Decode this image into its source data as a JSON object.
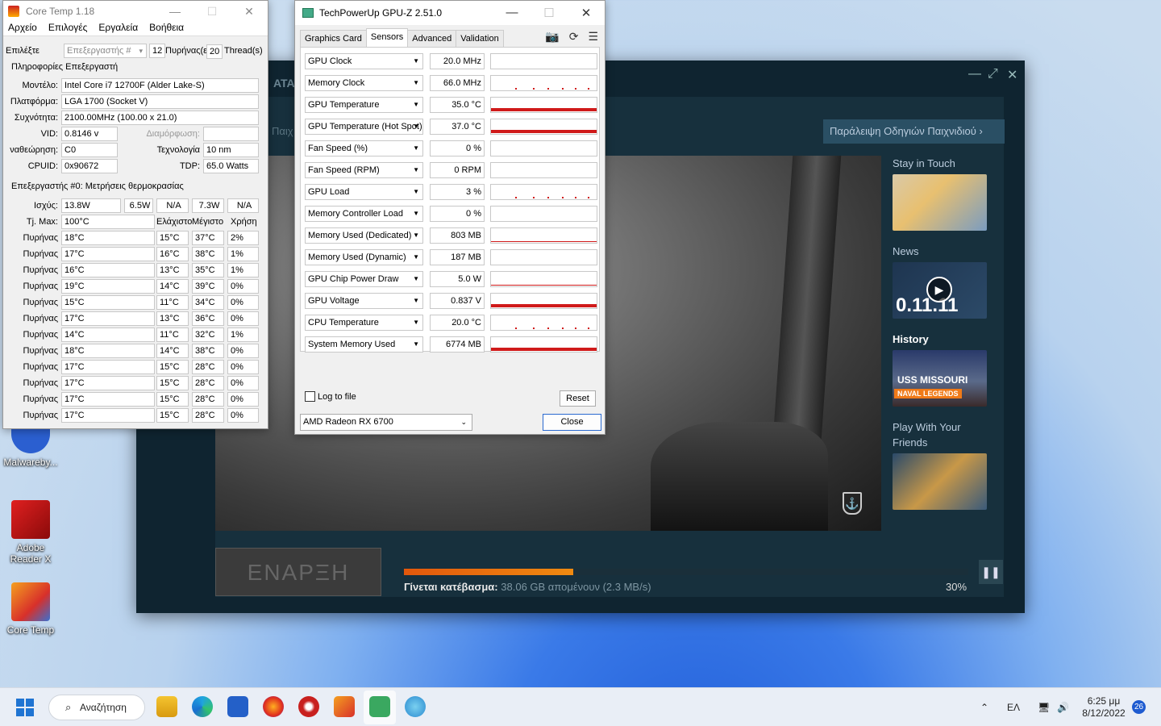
{
  "desktop": {
    "icons": [
      {
        "label": "Malwareby..."
      },
      {
        "label": "Adobe Reader X"
      },
      {
        "label": "Core Temp"
      }
    ]
  },
  "launcher": {
    "skip_button": "Παράλειψη Οδηγιών Παιχνιδιού",
    "sidebar": [
      {
        "title": "Stay in Touch"
      },
      {
        "title": "News",
        "badge": "0.11.11"
      },
      {
        "title": "History",
        "badge": "USS MISSOURI",
        "sub": "NAVAL LEGENDS"
      },
      {
        "title": "Play With Your Friends"
      }
    ],
    "start_button": "ΕΝΑΡΞΗ",
    "download": {
      "label": "Γίνεται κατέβασμα:",
      "remaining": "38.06 GB απομένουν",
      "speed": "(2.3 MB/s)",
      "percent_text": "30%",
      "progress": 0.3
    },
    "partial_text_1": "ΑΤΑΙ",
    "partial_text_2": "Παιχ"
  },
  "coretemp": {
    "title": "Core Temp 1.18",
    "menu": [
      "Αρχείο",
      "Επιλογές",
      "Εργαλεία",
      "Βοήθεια"
    ],
    "select_label": "Επιλέξτε",
    "processor_select": "Επεξεργαστής #",
    "cores_value": "12",
    "cores_label": "Πυρήνας(ε",
    "threads_value": "20",
    "threads_label": "Thread(s)",
    "info_group": "Πληροφορίες Επεξεργαστή",
    "model_label": "Μοντέλο:",
    "model": "Intel Core i7 12700F (Alder Lake-S)",
    "platform_label": "Πλατφόρμα:",
    "platform": "LGA 1700 (Socket V)",
    "freq_label": "Συχνότητα:",
    "freq": "2100.00MHz (100.00 x 21.0)",
    "vid_label": "VID:",
    "vid": "0.8146 v",
    "mod_label": "Διαμόρφωση:",
    "rev_label": "ναθεώρηση:",
    "rev": "C0",
    "tech_label": "Τεχνολογία",
    "tech": "10 nm",
    "cpuid_label": "CPUID:",
    "cpuid": "0x90672",
    "tdp_label": "TDP:",
    "tdp": "65.0 Watts",
    "temp_group": "Επεξεργαστής #0: Μετρήσεις θερμοκρασίας",
    "power_label": "Ισχύς:",
    "power": [
      "13.8W",
      "6.5W",
      "N/A",
      "7.3W",
      "N/A"
    ],
    "tjmax_label": "Tj. Max:",
    "tjmax": "100°C",
    "col_min": "Ελάχιστο",
    "col_max": "Μέγιστο",
    "col_load": "Χρήση",
    "core_label": "Πυρήνας",
    "cores": [
      {
        "t": "18°C",
        "min": "15°C",
        "max": "37°C",
        "load": "2%"
      },
      {
        "t": "17°C",
        "min": "16°C",
        "max": "38°C",
        "load": "1%"
      },
      {
        "t": "16°C",
        "min": "13°C",
        "max": "35°C",
        "load": "1%"
      },
      {
        "t": "19°C",
        "min": "14°C",
        "max": "39°C",
        "load": "0%"
      },
      {
        "t": "15°C",
        "min": "11°C",
        "max": "34°C",
        "load": "0%"
      },
      {
        "t": "17°C",
        "min": "13°C",
        "max": "36°C",
        "load": "0%"
      },
      {
        "t": "14°C",
        "min": "11°C",
        "max": "32°C",
        "load": "1%"
      },
      {
        "t": "18°C",
        "min": "14°C",
        "max": "38°C",
        "load": "0%"
      },
      {
        "t": "17°C",
        "min": "15°C",
        "max": "28°C",
        "load": "0%"
      },
      {
        "t": "17°C",
        "min": "15°C",
        "max": "28°C",
        "load": "0%"
      },
      {
        "t": "17°C",
        "min": "15°C",
        "max": "28°C",
        "load": "0%"
      },
      {
        "t": "17°C",
        "min": "15°C",
        "max": "28°C",
        "load": "0%"
      }
    ]
  },
  "gpuz": {
    "title": "TechPowerUp GPU-Z 2.51.0",
    "tabs": [
      "Graphics Card",
      "Sensors",
      "Advanced",
      "Validation"
    ],
    "active_tab": "Sensors",
    "sensors": [
      {
        "name": "GPU Clock",
        "value": "20.0 MHz",
        "graph": "none"
      },
      {
        "name": "Memory Clock",
        "value": "66.0 MHz",
        "graph": "spikes"
      },
      {
        "name": "GPU Temperature",
        "value": "35.0 °C",
        "graph": "bar"
      },
      {
        "name": "GPU Temperature (Hot Spot)",
        "value": "37.0 °C",
        "graph": "bar"
      },
      {
        "name": "Fan Speed (%)",
        "value": "0 %",
        "graph": "none"
      },
      {
        "name": "Fan Speed (RPM)",
        "value": "0 RPM",
        "graph": "none"
      },
      {
        "name": "GPU Load",
        "value": "3 %",
        "graph": "spikes"
      },
      {
        "name": "Memory Controller Load",
        "value": "0 %",
        "graph": "none"
      },
      {
        "name": "Memory Used (Dedicated)",
        "value": "803 MB",
        "graph": "thin"
      },
      {
        "name": "Memory Used (Dynamic)",
        "value": "187 MB",
        "graph": "none"
      },
      {
        "name": "GPU Chip Power Draw",
        "value": "5.0 W",
        "graph": "thin"
      },
      {
        "name": "GPU Voltage",
        "value": "0.837 V",
        "graph": "bar"
      },
      {
        "name": "CPU Temperature",
        "value": "20.0 °C",
        "graph": "spikes"
      },
      {
        "name": "System Memory Used",
        "value": "6774 MB",
        "graph": "bar"
      }
    ],
    "log_label": "Log to file",
    "reset_label": "Reset",
    "gpu_select": "AMD Radeon RX 6700",
    "close_label": "Close"
  },
  "taskbar": {
    "search_label": "Αναζήτηση",
    "lang": "ΕΛ",
    "time": "6:25 μμ",
    "date": "8/12/2022",
    "badge": "26"
  }
}
